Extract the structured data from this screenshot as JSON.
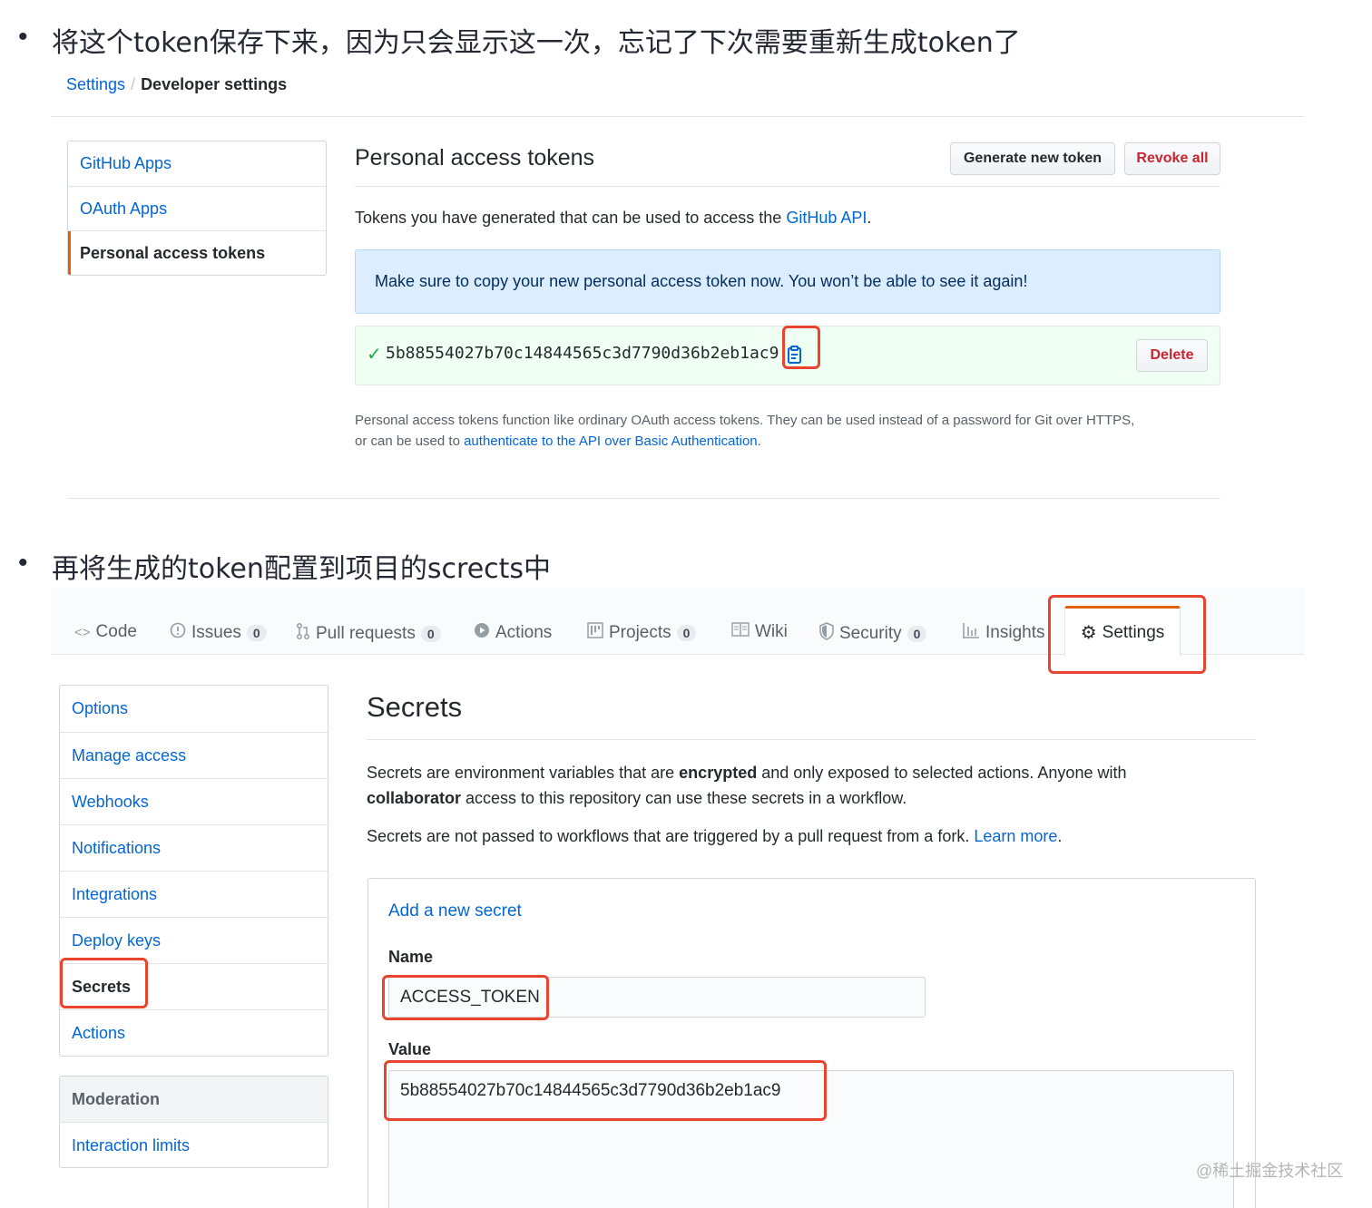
{
  "bullets": [
    "将这个token保存下来，因为只会显示这一次，忘记了下次需要重新生成token了",
    "再将生成的token配置到项目的scrects中"
  ],
  "top": {
    "breadcrumb": {
      "parent": "Settings",
      "current": "Developer settings"
    },
    "menu": [
      "GitHub Apps",
      "OAuth Apps",
      "Personal access tokens"
    ],
    "title": "Personal access tokens",
    "generate_label": "Generate new token",
    "revoke_label": "Revoke all",
    "intro_text": "Tokens you have generated that can be used to access the ",
    "intro_link": "GitHub API",
    "intro_end": ".",
    "flash": "Make sure to copy your new personal access token now. You won’t be able to see it again!",
    "token_value": "5b88554027b70c14844565c3d7790d36b2eb1ac9",
    "delete_label": "Delete",
    "note_line1": "Personal access tokens function like ordinary OAuth access tokens. They can be used instead of a password for Git over HTTPS,",
    "note_line2_start": "or can be used to ",
    "note_link": "authenticate to the API over Basic Authentication",
    "note_end": "."
  },
  "repo": {
    "tabs": [
      {
        "label": "Code",
        "icon": "code-icon"
      },
      {
        "label": "Issues",
        "icon": "issue-icon",
        "count": "0"
      },
      {
        "label": "Pull requests",
        "icon": "pull-request-icon",
        "count": "0"
      },
      {
        "label": "Actions",
        "icon": "play-icon"
      },
      {
        "label": "Projects",
        "icon": "project-icon",
        "count": "0"
      },
      {
        "label": "Wiki",
        "icon": "book-icon"
      },
      {
        "label": "Security",
        "icon": "shield-icon",
        "count": "0"
      },
      {
        "label": "Insights",
        "icon": "graph-icon"
      },
      {
        "label": "Settings",
        "icon": "gear-icon"
      }
    ],
    "menu": [
      "Options",
      "Manage access",
      "Webhooks",
      "Notifications",
      "Integrations",
      "Deploy keys",
      "Secrets",
      "Actions"
    ],
    "moderation": {
      "heading": "Moderation",
      "item": "Interaction limits"
    },
    "secrets": {
      "title": "Secrets",
      "p1_a": "Secrets are environment variables that are ",
      "p1_b": "encrypted",
      "p1_c": " and only exposed to selected actions. Anyone with",
      "p1_d": "collaborator",
      "p1_e": " access to this repository can use these secrets in a workflow.",
      "p2_a": "Secrets are not passed to workflows that are triggered by a pull request from a fork. ",
      "p2_link": "Learn more",
      "p2_end": ".",
      "add_link": "Add a new secret",
      "name_label": "Name",
      "name_value": "ACCESS_TOKEN",
      "value_label": "Value",
      "value_value": "5b88554027b70c14844565c3d7790d36b2eb1ac9"
    }
  },
  "watermark": "@稀土掘金技术社区",
  "colors": {
    "link": "#0366d6",
    "highlight": "#e8442e",
    "accent": "#e36209",
    "success": "#28a745"
  }
}
